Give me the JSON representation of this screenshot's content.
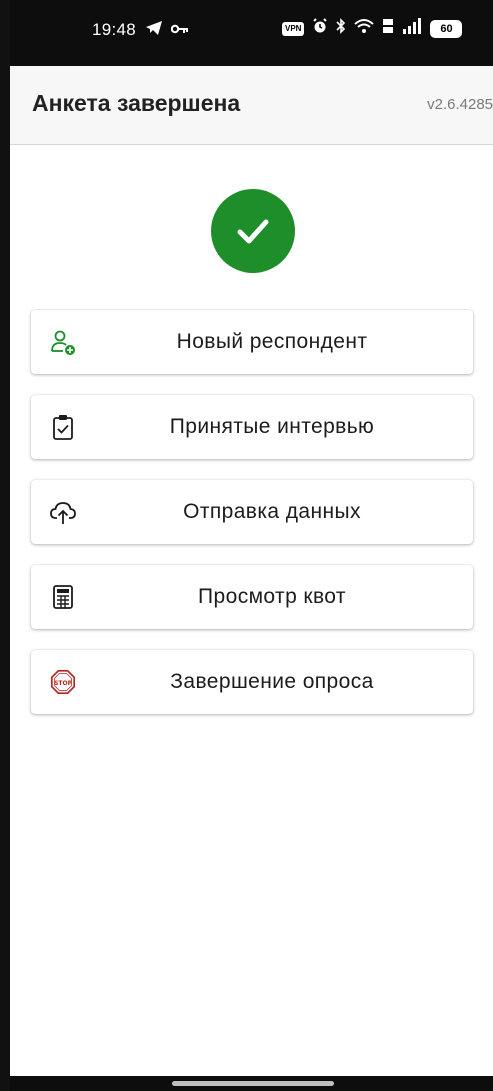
{
  "status_bar": {
    "time": "19:48",
    "battery": "60",
    "vpn_label": "VPN"
  },
  "app_bar": {
    "title": "Анкета завершена",
    "version": "v2.6.4285"
  },
  "colors": {
    "success": "#1e8e2a",
    "icon_green": "#1e8e2a",
    "stop_red": "#b3261e"
  },
  "menu": [
    {
      "label": "Новый респондент",
      "icon": "add-person-icon"
    },
    {
      "label": "Принятые интервью",
      "icon": "clipboard-check-icon"
    },
    {
      "label": "Отправка данных",
      "icon": "cloud-upload-icon"
    },
    {
      "label": "Просмотр квот",
      "icon": "calculator-icon"
    },
    {
      "label": "Завершение опроса",
      "icon": "stop-sign-icon"
    }
  ]
}
